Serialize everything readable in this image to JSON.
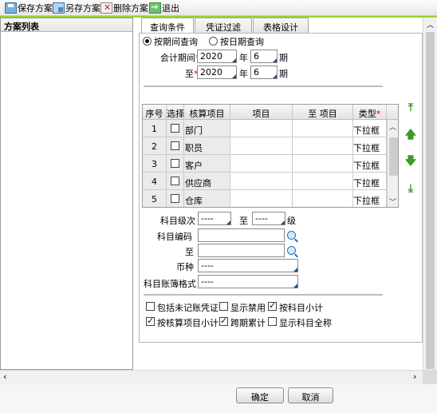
{
  "toolbar": {
    "save": "保存方案",
    "save_as": "另存方案",
    "delete": "删除方案",
    "exit": "退出"
  },
  "left_panel": {
    "title": "方案列表"
  },
  "tabs": [
    "查询条件",
    "凭证过滤",
    "表格设计"
  ],
  "query": {
    "radio_period": "按期间查询",
    "radio_date": "按日期查询",
    "period_label": "会计期间",
    "to_label": "至",
    "year_unit": "年",
    "period_unit": "期",
    "from_year": "2020",
    "from_period": "6",
    "to_year": "2020",
    "to_period": "6"
  },
  "grid": {
    "headers": [
      "序号",
      "选择",
      "核算项目",
      "项目",
      "至  项目",
      "类型"
    ],
    "rows": [
      {
        "no": "1",
        "name": "部门",
        "type": "下拉框"
      },
      {
        "no": "2",
        "name": "职员",
        "type": "下拉框"
      },
      {
        "no": "3",
        "name": "客户",
        "type": "下拉框"
      },
      {
        "no": "4",
        "name": "供应商",
        "type": "下拉框"
      },
      {
        "no": "5",
        "name": "仓库",
        "type": "下拉框"
      }
    ]
  },
  "filters": {
    "level_label": "科目级次",
    "level_from": "----",
    "level_to_label": "至",
    "level_to": "----",
    "level_unit": "级",
    "code_label": "科目编码",
    "code_to_label": "至",
    "currency_label": "币种",
    "currency_value": "----",
    "format_label": "科目账簿格式",
    "format_value": "----"
  },
  "options": [
    {
      "label": "包括未记账凭证",
      "checked": false
    },
    {
      "label": "显示禁用",
      "checked": false
    },
    {
      "label": "按科目小计",
      "checked": true
    },
    {
      "label": "按核算项目小计",
      "checked": true
    },
    {
      "label": "跨期累计",
      "checked": true
    },
    {
      "label": "显示科目全称",
      "checked": false
    }
  ],
  "buttons": {
    "ok": "确定",
    "cancel": "取消"
  },
  "colors": {
    "accent_green": "#9bd033",
    "required_mark": "#e00000",
    "move_arrows": "#3c9b24"
  }
}
